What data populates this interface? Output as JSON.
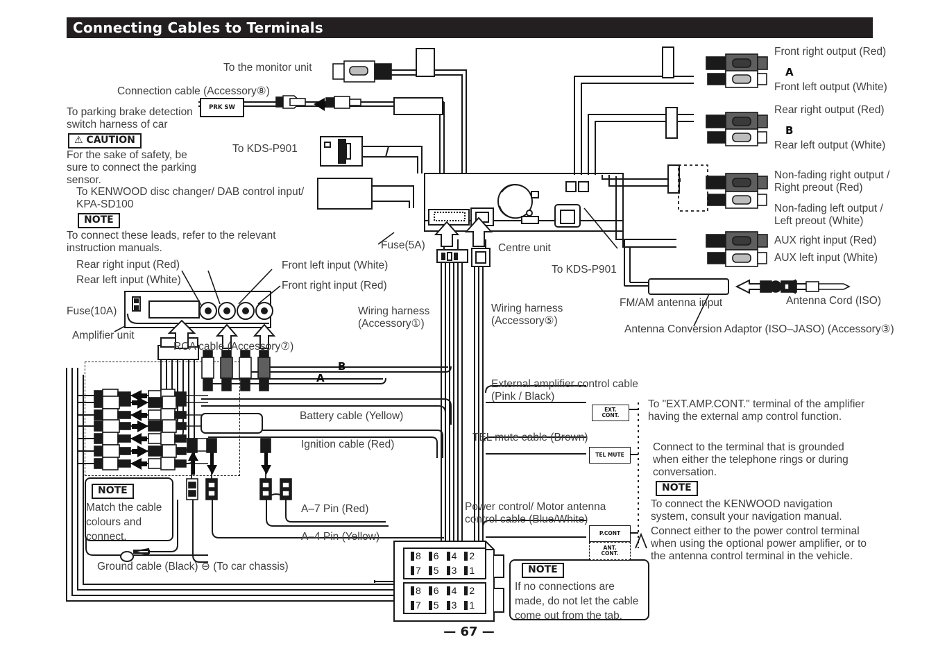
{
  "header": {
    "title": "Connecting Cables to Terminals"
  },
  "page": {
    "number": "— 67 —"
  },
  "labels": {
    "to_monitor_unit": "To the monitor unit",
    "connection_cable": "Connection cable (Accessory⑧)",
    "prk_sw": "PRK SW",
    "to_parking_brake": "To parking brake detection\nswitch harness of car",
    "caution_tag": "⚠ CAUTION",
    "caution_text": "For the sake of safety, be\nsure to connect the parking\nsensor.",
    "to_kenwood_changer": "To KENWOOD disc changer/ DAB control input/\nKPA-SD100",
    "note_tag": "NOTE",
    "note_leads": "To connect these leads, refer to the relevant\ninstruction manuals.",
    "to_kds_p901_left": "To KDS-P901",
    "to_kds_p901_right": "To KDS-P901",
    "rear_right_input": "Rear right input (Red)",
    "rear_left_input": "Rear left input (White)",
    "front_left_input": "Front left input (White)",
    "front_right_input": "Front right input (Red)",
    "fuse_10a": "Fuse(10A)",
    "amplifier_unit": "Amplifier unit",
    "fuse_5a": "Fuse(5A)",
    "centre_unit": "Centre unit",
    "wiring_harness_1": "Wiring harness\n(Accessory①)",
    "wiring_harness_5": "Wiring harness\n(Accessory⑤)",
    "rca_cable": "RCA cable (Accessory⑦)",
    "mark_a": "A",
    "mark_b": "B",
    "front_right_output": "Front right output (Red)",
    "front_left_output": "Front left output (White)",
    "rear_right_output": "Rear right output (Red)",
    "rear_left_output": "Rear left output (White)",
    "nonfading_right": "Non-fading right output /\nRight preout (Red)",
    "nonfading_left": "Non-fading left output /\nLeft preout (White)",
    "aux_right_input": "AUX right input (Red)",
    "aux_left_input": "AUX left input (White)",
    "fm_am_antenna": "FM/AM antenna input",
    "antenna_cord": "Antenna Cord (ISO)",
    "antenna_adaptor": "Antenna Conversion Adaptor (ISO–JASO) (Accessory③)",
    "ext_amp_cable": "External amplifier control cable\n(Pink / Black)",
    "tel_mute_cable": "TEL mute cable (Brown)",
    "power_control_cable": "Power control/ Motor antenna\ncontrol cable (Blue/White)",
    "battery_cable": "Battery cable (Yellow)",
    "ignition_cable": "Ignition cable (Red)",
    "a7_pin": "A–7 Pin (Red)",
    "a4_pin": "A–4 Pin (Yellow)",
    "ground_cable": "Ground cable (Black) ⊖ (To car chassis)",
    "note_match": "Match the cable\ncolours and\nconnect.",
    "note_tab": "If no connections are\nmade, do not let the cable\ncome out from the tab.",
    "ext_cont_box": "EXT.\nCONT.",
    "tel_mute_box": "TEL MUTE",
    "p_cont_box": "P.CONT",
    "ant_cont_box": "ANT.\nCONT.",
    "ext_amp_desc": "To \"EXT.AMP.CONT.\" terminal of the amplifier\nhaving the external amp control function.",
    "tel_mute_desc": "Connect to the terminal that is grounded\nwhen either the telephone rings or during\nconversation.",
    "nav_note": "To connect the KENWOOD navigation\nsystem, consult your navigation manual.",
    "p_cont_desc": "Connect either to the power control terminal\nwhen using the optional power amplifier, or to\nthe antenna control terminal in the vehicle."
  },
  "pins": {
    "top_row": [
      "8",
      "6",
      "4",
      "2"
    ],
    "bottom_row": [
      "7",
      "5",
      "3",
      "1"
    ]
  },
  "colors": {
    "header_bg": "#231f20",
    "ink": "#1a1a1a",
    "text": "#3f3f3f",
    "plug_red": "#5e5e5e",
    "plug_white": "#ffffff"
  }
}
